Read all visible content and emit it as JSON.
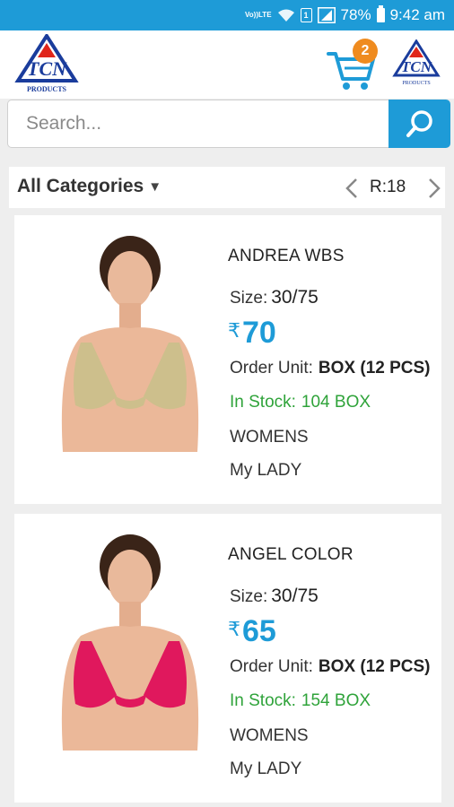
{
  "status_bar": {
    "volte_top": "Vo))",
    "volte_bottom": "LTE",
    "sim": "1",
    "battery": "78%",
    "time": "9:42 am",
    "icons": [
      "volte-icon",
      "wifi-icon",
      "sim-icon",
      "signal-icon",
      "battery-icon"
    ]
  },
  "header": {
    "logo_text": "PRODUCTS",
    "cart_count": "2"
  },
  "search": {
    "placeholder": "Search..."
  },
  "category_bar": {
    "label": "All Categories",
    "caret": "▼",
    "record_count": "R:18"
  },
  "products": [
    {
      "name": "ANDREA WBS",
      "size_label": "Size:",
      "size": "30/75",
      "currency": "₹",
      "price": "70",
      "unit_label": "Order Unit:",
      "unit": "BOX (12 PCS)",
      "stock_label": "In Stock:",
      "stock": "104 BOX",
      "gender": "WOMENS",
      "brand": "My LADY",
      "garment_color": "#cdbf8c"
    },
    {
      "name": "ANGEL COLOR",
      "size_label": "Size:",
      "size": "30/75",
      "currency": "₹",
      "price": "65",
      "unit_label": "Order Unit:",
      "unit": "BOX (12 PCS)",
      "stock_label": "In Stock:",
      "stock": "154 BOX",
      "gender": "WOMENS",
      "brand": "My LADY",
      "garment_color": "#e0185d"
    }
  ],
  "colors": {
    "accent": "#1e9bd7",
    "badge": "#ef8b1f",
    "in_stock": "#2fa33a",
    "logo_blue": "#1a3c9c",
    "logo_red": "#e0261b"
  }
}
